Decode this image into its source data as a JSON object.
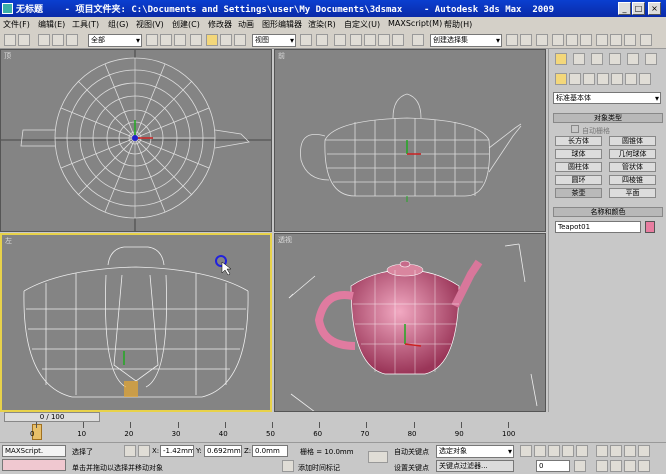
{
  "window": {
    "title": "无标题    - 项目文件夹: C:\\Documents and Settings\\user\\My Documents\\3dsmax    - Autodesk 3ds Max  2009"
  },
  "menu": [
    "文件(F)",
    "编辑(E)",
    "工具(T)",
    "组(G)",
    "视图(V)",
    "创建(C)",
    "修改器",
    "动画",
    "图形编辑器",
    "渲染(R)",
    "自定义(U)",
    "MAXScript(M)",
    "帮助(H)"
  ],
  "toolbar": {
    "selection_filter": "全部",
    "ref_coord": "视图",
    "named_selection": "创建选择集"
  },
  "viewports": {
    "top": "顶",
    "front": "前",
    "left": "左",
    "perspective": "透视"
  },
  "panel": {
    "primitive_type": "标准基本体",
    "object_type_title": "对象类型",
    "autogrid": "自动栅格",
    "buttons": [
      "长方体",
      "圆锥体",
      "球体",
      "几何球体",
      "圆柱体",
      "管状体",
      "圆环",
      "四棱锥",
      "茶壶",
      "平面"
    ],
    "name_color_title": "名称和颜色",
    "object_name": "Teapot01",
    "object_color": "#e87da0"
  },
  "timeline": {
    "frame": "0 / 100",
    "ticks": [
      "0",
      "10",
      "20",
      "30",
      "40",
      "50",
      "60",
      "70",
      "80",
      "90",
      "100"
    ]
  },
  "status": {
    "maxscript": "MAXScript.",
    "selected": "选择了",
    "x_value": "-1.42mm",
    "y_value": "0.692mm",
    "z_value": "0.0mm",
    "grid": "栅格 = 10.0mm",
    "autokey": "自动关键点",
    "selected_obj": "选定对象",
    "setkey": "设置关键点",
    "key_filters": "关键点过滤器...",
    "prompt": "单击并拖动以选择并移动对象",
    "add_time_tag": "添加时间标记",
    "frame_field": "0",
    "x_label": "X:",
    "y_label": "Y:",
    "z_label": "Z:"
  }
}
